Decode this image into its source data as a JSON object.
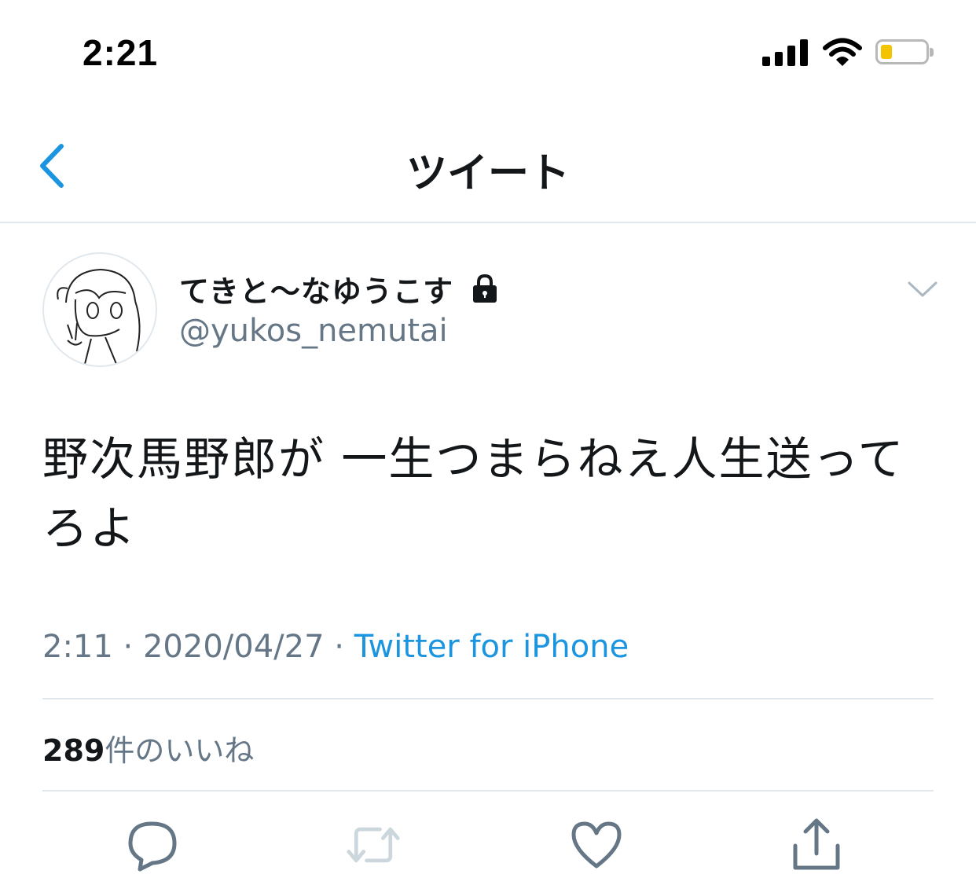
{
  "status_bar": {
    "time": "2:21"
  },
  "nav": {
    "title": "ツイート",
    "back_icon": "chevron-left-icon"
  },
  "tweet": {
    "display_name": "てきと〜なゆうこす",
    "username": "@yukos_nemutai",
    "text": "野次馬野郎が 一生つまらねえ人生送ってろよ",
    "time": "2:11",
    "separator": " · ",
    "date": "2020/04/27",
    "source": "Twitter for iPhone",
    "likes_count": "289",
    "likes_label": "件のいいね"
  },
  "actions": {
    "reply_icon": "reply-icon",
    "retweet_icon": "retweet-icon",
    "like_icon": "heart-icon",
    "share_icon": "share-icon"
  },
  "colors": {
    "accent": "#1b95e0",
    "secondary_text": "#657786",
    "divider": "#e1e8ed",
    "battery_level": "#f5c400"
  }
}
